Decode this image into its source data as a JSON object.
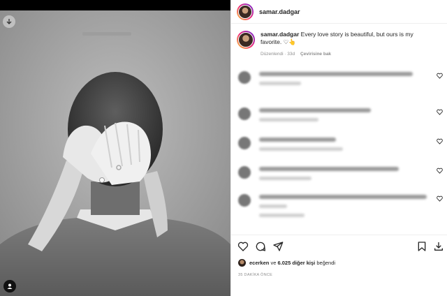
{
  "post": {
    "username": "samar.dadgar",
    "caption_text": "Every love story is beautiful, but ours is my favorite. ♡👆",
    "edited_label": "Düzenlendi · 33d",
    "translate_label": "Çevirisine bak"
  },
  "likes": {
    "liker": "ecerken",
    "conj": "ve",
    "count": "6.025 diğer kişi",
    "suffix": "beğendi"
  },
  "time_ago": "35 DAKİKA ÖNCE",
  "icons": {
    "download": "download-icon",
    "tag": "person-tag-icon",
    "like": "heart-icon",
    "comment": "comment-icon",
    "share": "send-icon",
    "save": "bookmark-icon",
    "download2": "download-icon"
  }
}
